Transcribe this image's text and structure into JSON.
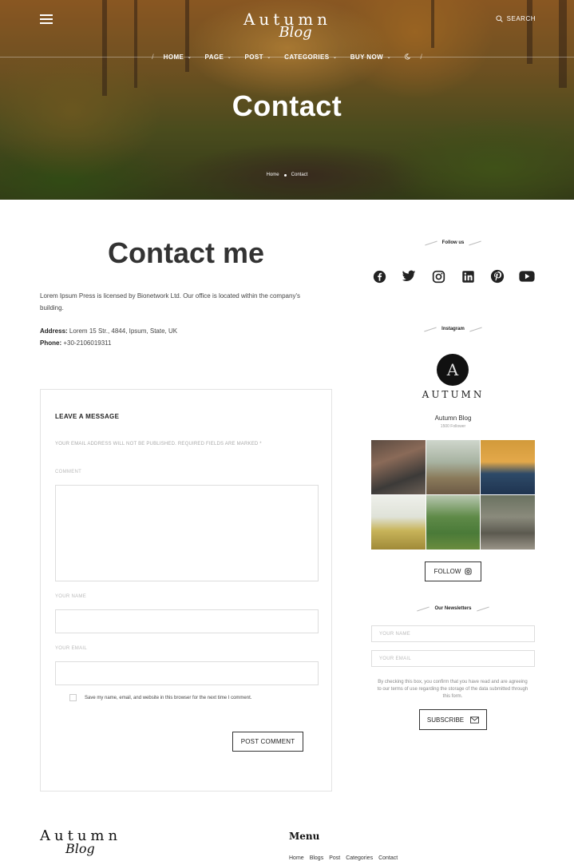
{
  "header": {
    "logo_main": "Autumn",
    "logo_script": "Blog",
    "search_label": "SEARCH",
    "nav": [
      {
        "label": "HOME",
        "has_dropdown": true
      },
      {
        "label": "PAGE",
        "has_dropdown": true
      },
      {
        "label": "POST",
        "has_dropdown": true
      },
      {
        "label": "CATEGORIES",
        "has_dropdown": true
      },
      {
        "label": "BUY NOW",
        "has_dropdown": true
      }
    ]
  },
  "hero": {
    "title": "Contact",
    "breadcrumb": [
      "Home",
      "Contact"
    ]
  },
  "contact": {
    "title": "Contact me",
    "intro": "Lorem Ipsum Press is licensed by Bionetwork Ltd. Our office is located within the company's building.",
    "address_label": "Address:",
    "address_value": "Lorem 15 Str., 4844, Ipsum, State, UK",
    "phone_label": "Phone:",
    "phone_value": "+30-2106019311"
  },
  "form": {
    "title": "LEAVE A MESSAGE",
    "note": "YOUR EMAIL ADDRESS WILL NOT BE PUBLISHED. REQUIRED FIELDS ARE MARKED *",
    "comment_label": "COMMENT",
    "name_label": "YOUR NAME",
    "email_label": "YOUR EMAIL",
    "remember_label": "Save my name, email, and website in this browser for the next time I comment.",
    "submit_label": "POST COMMENT"
  },
  "sidebar": {
    "follow_title": "Follow us",
    "socials": [
      "facebook-icon",
      "twitter-icon",
      "instagram-icon",
      "linkedin-icon",
      "pinterest-icon",
      "youtube-icon"
    ],
    "instagram_title": "Instagram",
    "ig_avatar_letter": "A",
    "ig_brand": "AUTUMN",
    "ig_name": "Autumn Blog",
    "ig_followers": "1500 Follower",
    "follow_button": "FOLLOW",
    "newsletter_title": "Our Newsletters",
    "nl_name_placeholder": "YOUR NAME",
    "nl_email_placeholder": "YOUR EMAIL",
    "nl_note": "By checking this box, you confirm that you have read and are agreeing to our terms of use regarding the storage of the data submitted through this form.",
    "subscribe_label": "SUBSCRIBE"
  },
  "footer": {
    "logo_main": "Autumn",
    "logo_script": "Blog",
    "menu_title": "Menu",
    "menu_items": [
      "Home",
      "Blogs",
      "Post",
      "Categories",
      "Contact"
    ]
  },
  "colors": {
    "text": "#222222",
    "muted": "#aaaaaa",
    "border": "#dddddd",
    "hero_tone": "#8f6a2a"
  }
}
